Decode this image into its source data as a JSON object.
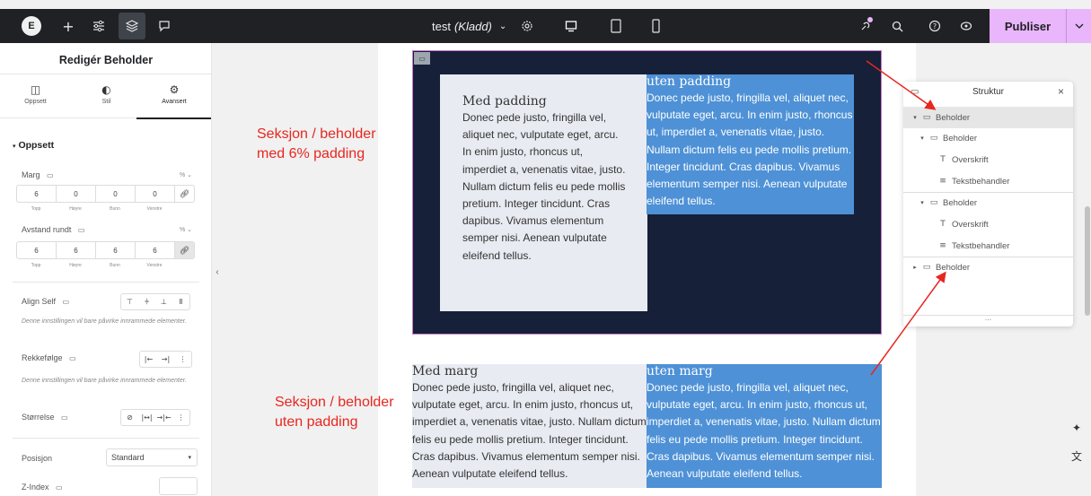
{
  "topbar": {
    "logo": "E",
    "doc_name": "test",
    "doc_status": "(Kladd)",
    "publish_label": "Publiser",
    "icons": [
      "add-icon",
      "settings-sliders-icon",
      "layers-icon",
      "comment-icon",
      "page-settings-icon",
      "desktop-icon",
      "tablet-icon",
      "mobile-icon",
      "integrations-icon",
      "search-icon",
      "help-icon",
      "preview-icon",
      "chevron-down-icon"
    ]
  },
  "panel": {
    "title": "Redigér Beholder",
    "tabs": [
      {
        "label": "Oppsett",
        "icon": "layout-icon"
      },
      {
        "label": "Stil",
        "icon": "style-icon"
      },
      {
        "label": "Avansert",
        "icon": "gear-icon"
      }
    ],
    "section": "Oppsett",
    "margin": {
      "label": "Marg",
      "unit": "% ⌄",
      "values": [
        "6",
        "0",
        "0",
        "0"
      ],
      "sides": [
        "Topp",
        "Høyre",
        "Bunn",
        "Venstre"
      ]
    },
    "padding": {
      "label": "Avstand rundt",
      "unit": "% ⌄",
      "values": [
        "6",
        "6",
        "6",
        "6"
      ],
      "sides": [
        "Topp",
        "Høyre",
        "Bunn",
        "Venstre"
      ]
    },
    "align_self_label": "Align Self",
    "hint": "Denne innstillingen vil bare påvirke innrammede elementer.",
    "order_label": "Rekkefølge",
    "size_label": "Størrelse",
    "position_label": "Posisjon",
    "position_value": "Standard",
    "zindex_label": "Z-Index"
  },
  "canvas": {
    "section_padded": {
      "left": {
        "heading": "Med padding",
        "text": "Donec pede justo, fringilla vel, aliquet nec, vulputate eget, arcu. In enim justo, rhoncus ut, imperdiet a, venenatis vitae, justo. Nullam dictum felis eu pede mollis pretium. Integer tincidunt. Cras dapibus. Vivamus elementum semper nisi. Aenean vulputate eleifend tellus."
      },
      "right": {
        "heading": "uten padding",
        "text": "Donec pede justo, fringilla vel, aliquet nec, vulputate eget, arcu. In enim justo, rhoncus ut, imperdiet a, venenatis vitae, justo. Nullam dictum felis eu pede mollis pretium. Integer tincidunt. Cras dapibus. Vivamus elementum semper nisi. Aenean vulputate eleifend tellus."
      }
    },
    "section_plain": {
      "left": {
        "heading": "Med marg",
        "text": "Donec pede justo, fringilla vel, aliquet nec, vulputate eget, arcu. In enim justo, rhoncus ut, imperdiet a, venenatis vitae, justo. Nullam dictum felis eu pede mollis pretium. Integer tincidunt. Cras dapibus. Vivamus elementum semper nisi. Aenean vulputate eleifend tellus."
      },
      "right": {
        "heading": "uten marg",
        "text": "Donec pede justo, fringilla vel, aliquet nec, vulputate eget, arcu. In enim justo, rhoncus ut, imperdiet a, venenatis vitae, justo. Nullam dictum felis eu pede mollis pretium. Integer tincidunt. Cras dapibus. Vivamus elementum semper nisi. Aenean vulputate eleifend tellus."
      }
    }
  },
  "annotations": {
    "top_line1": "Seksjon / beholder",
    "top_line2": "med 6% padding",
    "bottom_line1": "Seksjon / beholder",
    "bottom_line2": "uten padding"
  },
  "structure": {
    "title": "Struktur",
    "items": [
      {
        "label": "Beholder",
        "icon": "container-icon",
        "level": 0,
        "toggle": "▾",
        "selected": true
      },
      {
        "label": "Beholder",
        "icon": "container-icon",
        "level": 1,
        "toggle": "▾"
      },
      {
        "label": "Overskrift",
        "icon": "heading-icon",
        "level": 2
      },
      {
        "label": "Tekstbehandler",
        "icon": "text-editor-icon",
        "level": 2
      },
      {
        "label": "Beholder",
        "icon": "container-icon",
        "level": 1,
        "toggle": "▾"
      },
      {
        "label": "Overskrift",
        "icon": "heading-icon",
        "level": 2
      },
      {
        "label": "Tekstbehandler",
        "icon": "text-editor-icon",
        "level": 2
      },
      {
        "label": "Beholder",
        "icon": "container-icon",
        "level": 0,
        "toggle": "▸"
      }
    ],
    "more": "..."
  },
  "colors": {
    "topbar": "#1f2124",
    "publish": "#e9b5fb",
    "section_dark": "#162039",
    "box_grey": "#e9ebf2",
    "box_blue": "#4e91d6",
    "annotation": "#e8261f"
  }
}
